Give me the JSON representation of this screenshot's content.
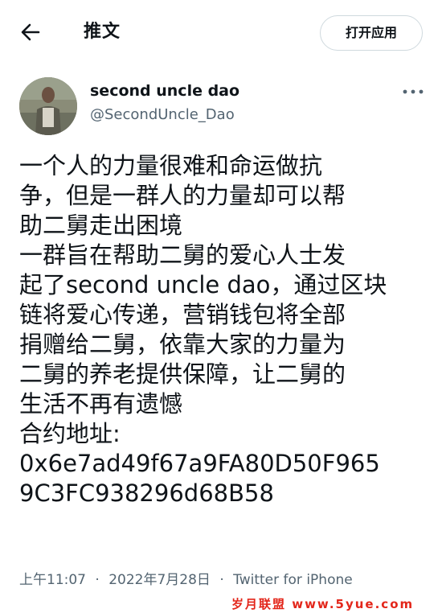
{
  "header": {
    "title": "推文",
    "open_app_label": "打开应用",
    "back_icon": "arrow-left-icon"
  },
  "author": {
    "name": "second uncle dao",
    "handle": "@SecondUncle_Dao",
    "more_icon": "more-horizontal-icon"
  },
  "tweet": {
    "lines": [
      "一个人的力量很难和命运做抗",
      "争，但是一群人的力量却可以帮",
      "助二舅走出困境",
      "一群旨在帮助二舅的爱心人士发",
      "起了second uncle dao，通过区块",
      "链将爱心传递，营销钱包将全部",
      "捐赠给二舅，依靠大家的力量为",
      "二舅的养老提供保障，让二舅的",
      "生活不再有遗憾",
      "合约地址:",
      "0x6e7ad49f67a9FA80D50F965",
      "9C3FC938296d68B58"
    ]
  },
  "meta": {
    "time": "上午11:07",
    "date": "2022年7月28日",
    "source": "Twitter for iPhone",
    "separator": "·"
  },
  "watermark": {
    "text": "岁月联盟 www.5yue.com"
  },
  "colors": {
    "text_primary": "#0f1419",
    "text_secondary": "#536471",
    "border": "#cfd9de",
    "watermark": "#e3261a"
  }
}
